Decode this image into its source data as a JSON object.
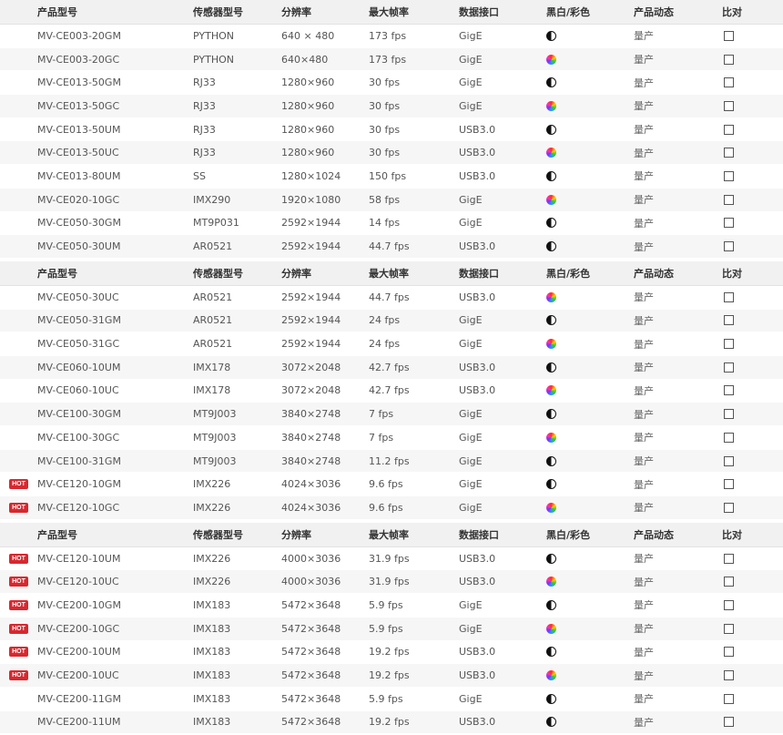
{
  "columns": {
    "model": "产品型号",
    "sensor": "传感器型号",
    "resolution": "分辨率",
    "fps": "最大帧率",
    "interface": "数据接口",
    "color": "黑白/彩色",
    "status": "产品动态",
    "compare": "比对"
  },
  "hot_label": "HOT",
  "icons": {
    "mono": "mono-half-circle-icon",
    "color": "color-wheel-icon"
  },
  "sections": [
    {
      "rows": [
        {
          "hot": false,
          "model": "MV-CE003-20GM",
          "sensor": "PYTHON",
          "resolution": "640 × 480",
          "fps": "173 fps",
          "interface": "GigE",
          "type": "mono",
          "status": "量产"
        },
        {
          "hot": false,
          "model": "MV-CE003-20GC",
          "sensor": "PYTHON",
          "resolution": "640×480",
          "fps": "173 fps",
          "interface": "GigE",
          "type": "color",
          "status": "量产"
        },
        {
          "hot": false,
          "model": "MV-CE013-50GM",
          "sensor": "RJ33",
          "resolution": "1280×960",
          "fps": "30 fps",
          "interface": "GigE",
          "type": "mono",
          "status": "量产"
        },
        {
          "hot": false,
          "model": "MV-CE013-50GC",
          "sensor": "RJ33",
          "resolution": "1280×960",
          "fps": "30 fps",
          "interface": "GigE",
          "type": "color",
          "status": "量产"
        },
        {
          "hot": false,
          "model": "MV-CE013-50UM",
          "sensor": "RJ33",
          "resolution": "1280×960",
          "fps": "30 fps",
          "interface": "USB3.0",
          "type": "mono",
          "status": "量产"
        },
        {
          "hot": false,
          "model": "MV-CE013-50UC",
          "sensor": "RJ33",
          "resolution": "1280×960",
          "fps": "30 fps",
          "interface": "USB3.0",
          "type": "color",
          "status": "量产"
        },
        {
          "hot": false,
          "model": "MV-CE013-80UM",
          "sensor": "SS",
          "resolution": "1280×1024",
          "fps": "150 fps",
          "interface": "USB3.0",
          "type": "mono",
          "status": "量产"
        },
        {
          "hot": false,
          "model": "MV-CE020-10GC",
          "sensor": "IMX290",
          "resolution": "1920×1080",
          "fps": "58 fps",
          "interface": "GigE",
          "type": "color",
          "status": "量产"
        },
        {
          "hot": false,
          "model": "MV-CE050-30GM",
          "sensor": "MT9P031",
          "resolution": "2592×1944",
          "fps": "14 fps",
          "interface": "GigE",
          "type": "mono",
          "status": "量产"
        },
        {
          "hot": false,
          "model": "MV-CE050-30UM",
          "sensor": "AR0521",
          "resolution": "2592×1944",
          "fps": "44.7 fps",
          "interface": "USB3.0",
          "type": "mono",
          "status": "量产"
        }
      ]
    },
    {
      "rows": [
        {
          "hot": false,
          "model": "MV-CE050-30UC",
          "sensor": "AR0521",
          "resolution": "2592×1944",
          "fps": "44.7 fps",
          "interface": "USB3.0",
          "type": "color",
          "status": "量产"
        },
        {
          "hot": false,
          "model": "MV-CE050-31GM",
          "sensor": "AR0521",
          "resolution": "2592×1944",
          "fps": "24 fps",
          "interface": "GigE",
          "type": "mono",
          "status": "量产"
        },
        {
          "hot": false,
          "model": "MV-CE050-31GC",
          "sensor": "AR0521",
          "resolution": "2592×1944",
          "fps": "24 fps",
          "interface": "GigE",
          "type": "color",
          "status": "量产"
        },
        {
          "hot": false,
          "model": "MV-CE060-10UM",
          "sensor": "IMX178",
          "resolution": "3072×2048",
          "fps": "42.7 fps",
          "interface": "USB3.0",
          "type": "mono",
          "status": "量产"
        },
        {
          "hot": false,
          "model": "MV-CE060-10UC",
          "sensor": "IMX178",
          "resolution": "3072×2048",
          "fps": "42.7 fps",
          "interface": "USB3.0",
          "type": "color",
          "status": "量产"
        },
        {
          "hot": false,
          "model": "MV-CE100-30GM",
          "sensor": "MT9J003",
          "resolution": "3840×2748",
          "fps": "7 fps",
          "interface": "GigE",
          "type": "mono",
          "status": "量产"
        },
        {
          "hot": false,
          "model": "MV-CE100-30GC",
          "sensor": "MT9J003",
          "resolution": "3840×2748",
          "fps": "7 fps",
          "interface": "GigE",
          "type": "color",
          "status": "量产"
        },
        {
          "hot": false,
          "model": "MV-CE100-31GM",
          "sensor": "MT9J003",
          "resolution": "3840×2748",
          "fps": "11.2 fps",
          "interface": "GigE",
          "type": "mono",
          "status": "量产"
        },
        {
          "hot": true,
          "model": "MV-CE120-10GM",
          "sensor": "IMX226",
          "resolution": "4024×3036",
          "fps": "9.6 fps",
          "interface": "GigE",
          "type": "mono",
          "status": "量产"
        },
        {
          "hot": true,
          "model": "MV-CE120-10GC",
          "sensor": "IMX226",
          "resolution": "4024×3036",
          "fps": "9.6 fps",
          "interface": "GigE",
          "type": "color",
          "status": "量产"
        }
      ]
    },
    {
      "rows": [
        {
          "hot": true,
          "model": "MV-CE120-10UM",
          "sensor": "IMX226",
          "resolution": "4000×3036",
          "fps": "31.9 fps",
          "interface": "USB3.0",
          "type": "mono",
          "status": "量产"
        },
        {
          "hot": true,
          "model": "MV-CE120-10UC",
          "sensor": "IMX226",
          "resolution": "4000×3036",
          "fps": "31.9 fps",
          "interface": "USB3.0",
          "type": "color",
          "status": "量产"
        },
        {
          "hot": true,
          "model": "MV-CE200-10GM",
          "sensor": "IMX183",
          "resolution": "5472×3648",
          "fps": "5.9 fps",
          "interface": "GigE",
          "type": "mono",
          "status": "量产"
        },
        {
          "hot": true,
          "model": "MV-CE200-10GC",
          "sensor": "IMX183",
          "resolution": "5472×3648",
          "fps": "5.9 fps",
          "interface": "GigE",
          "type": "color",
          "status": "量产"
        },
        {
          "hot": true,
          "model": "MV-CE200-10UM",
          "sensor": "IMX183",
          "resolution": "5472×3648",
          "fps": "19.2 fps",
          "interface": "USB3.0",
          "type": "mono",
          "status": "量产"
        },
        {
          "hot": true,
          "model": "MV-CE200-10UC",
          "sensor": "IMX183",
          "resolution": "5472×3648",
          "fps": "19.2 fps",
          "interface": "USB3.0",
          "type": "color",
          "status": "量产"
        },
        {
          "hot": false,
          "model": "MV-CE200-11GM",
          "sensor": "IMX183",
          "resolution": "5472×3648",
          "fps": "5.9 fps",
          "interface": "GigE",
          "type": "mono",
          "status": "量产"
        },
        {
          "hot": false,
          "model": "MV-CE200-11UM",
          "sensor": "IMX183",
          "resolution": "5472×3648",
          "fps": "19.2 fps",
          "interface": "USB3.0",
          "type": "mono",
          "status": "量产"
        }
      ]
    }
  ]
}
